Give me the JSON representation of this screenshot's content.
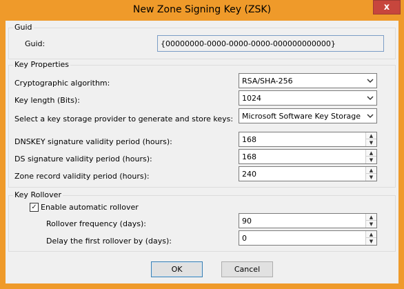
{
  "window": {
    "title": "New Zone Signing Key (ZSK)",
    "close_glyph": "x"
  },
  "guid_group": {
    "label": "Guid",
    "field_label": "Guid:",
    "value": "{00000000-0000-0000-0000-000000000000}"
  },
  "key_properties": {
    "label": "Key Properties",
    "algorithm": {
      "label": "Cryptographic algorithm:",
      "value": "RSA/SHA-256"
    },
    "key_length": {
      "label": "Key length (Bits):",
      "value": "1024"
    },
    "provider": {
      "label": "Select a key storage provider to generate and store keys:",
      "value": "Microsoft Software Key Storage Prov"
    },
    "dnskey_validity": {
      "label": "DNSKEY signature validity period (hours):",
      "value": "168"
    },
    "ds_validity": {
      "label": "DS signature validity period (hours):",
      "value": "168"
    },
    "zone_validity": {
      "label": "Zone record validity period (hours):",
      "value": "240"
    }
  },
  "key_rollover": {
    "label": "Key Rollover",
    "enable_label": "Enable automatic rollover",
    "enable_checked": true,
    "check_glyph": "✓",
    "frequency": {
      "label": "Rollover frequency (days):",
      "value": "90"
    },
    "delay": {
      "label": "Delay the first rollover by (days):",
      "value": "0"
    }
  },
  "buttons": {
    "ok": "OK",
    "cancel": "Cancel"
  },
  "colors": {
    "titlebar": "#ef9a2a",
    "close": "#c7463d",
    "client": "#f0f0f0"
  }
}
